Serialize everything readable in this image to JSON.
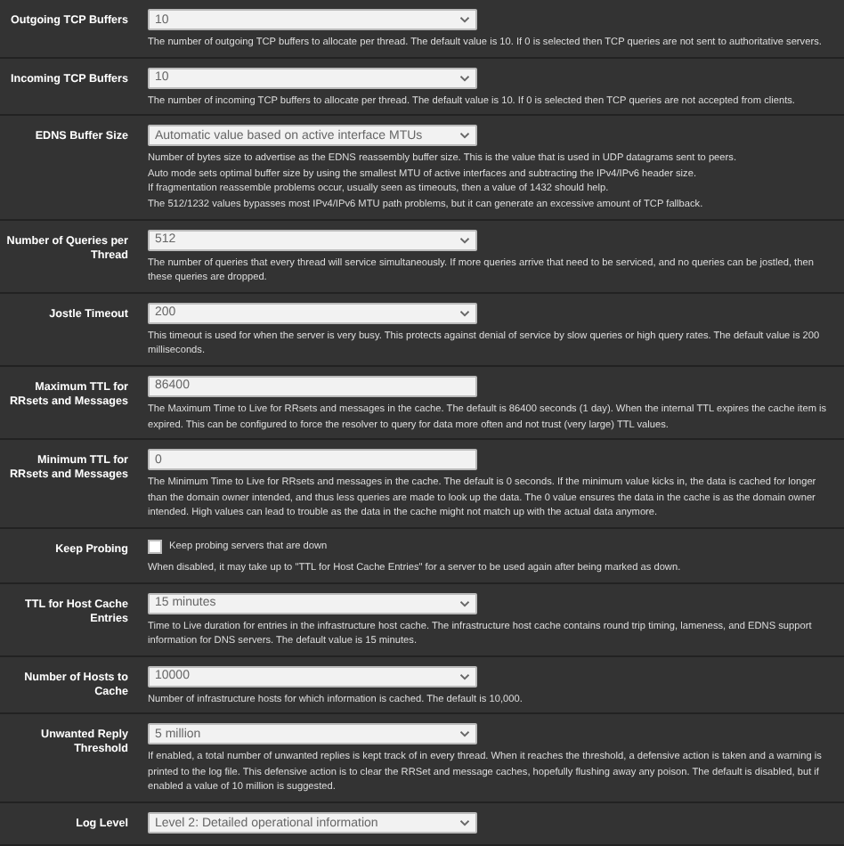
{
  "settings": [
    {
      "kind": "select",
      "label": "Outgoing TCP Buffers",
      "value": "10",
      "help": [
        "The number of outgoing TCP buffers to allocate per thread. The default value is 10. If 0 is selected then TCP queries are not sent to authoritative servers."
      ]
    },
    {
      "kind": "select",
      "label": "Incoming TCP Buffers",
      "value": "10",
      "help": [
        "The number of incoming TCP buffers to allocate per thread. The default value is 10. If 0 is selected then TCP queries are not accepted from clients."
      ]
    },
    {
      "kind": "select",
      "label": "EDNS Buffer Size",
      "value": "Automatic value based on active interface MTUs",
      "help": [
        "Number of bytes size to advertise as the EDNS reassembly buffer size. This is the value that is used in UDP datagrams sent to peers.",
        "Auto mode sets optimal buffer size by using the smallest MTU of active interfaces and subtracting the IPv4/IPv6 header size.",
        "If fragmentation reassemble problems occur, usually seen as timeouts, then a value of 1432 should help.",
        "The 512/1232 values bypasses most IPv4/IPv6 MTU path problems, but it can generate an excessive amount of TCP fallback."
      ]
    },
    {
      "kind": "select",
      "label": "Number of Queries per Thread",
      "value": "512",
      "help": [
        "The number of queries that every thread will service simultaneously. If more queries arrive that need to be serviced, and no queries can be jostled, then these queries are dropped."
      ]
    },
    {
      "kind": "select",
      "label": "Jostle Timeout",
      "value": "200",
      "help": [
        "This timeout is used for when the server is very busy. This protects against denial of service by slow queries or high query rates. The default value is 200 milliseconds."
      ]
    },
    {
      "kind": "input",
      "label": "Maximum TTL for RRsets and Messages",
      "value": "86400",
      "help": [
        "The Maximum Time to Live for RRsets and messages in the cache. The default is 86400 seconds (1 day). When the internal TTL expires the cache item is expired. This can be configured to force the resolver to query for data more often and not trust (very large) TTL values."
      ]
    },
    {
      "kind": "input",
      "label": "Minimum TTL for RRsets and Messages",
      "value": "0",
      "help": [
        "The Minimum Time to Live for RRsets and messages in the cache. The default is 0 seconds. If the minimum value kicks in, the data is cached for longer than the domain owner intended, and thus less queries are made to look up the data. The 0 value ensures the data in the cache is as the domain owner intended. High values can lead to trouble as the data in the cache might not match up with the actual data anymore."
      ]
    },
    {
      "kind": "checkbox",
      "label": "Keep Probing",
      "value": "Keep probing servers that are down",
      "checked": false,
      "help": [
        "When disabled, it may take up to \"TTL for Host Cache Entries\" for a server to be used again after being marked as down."
      ]
    },
    {
      "kind": "select",
      "label": "TTL for Host Cache Entries",
      "value": "15 minutes",
      "help": [
        "Time to Live duration for entries in the infrastructure host cache. The infrastructure host cache contains round trip timing, lameness, and EDNS support information for DNS servers. The default value is 15 minutes."
      ]
    },
    {
      "kind": "select",
      "label": "Number of Hosts to Cache",
      "value": "10000",
      "help": [
        "Number of infrastructure hosts for which information is cached. The default is 10,000."
      ]
    },
    {
      "kind": "select",
      "label": "Unwanted Reply Threshold",
      "value": "5 million",
      "help": [
        "If enabled, a total number of unwanted replies is kept track of in every thread. When it reaches the threshold, a defensive action is taken and a warning is printed to the log file. This defensive action is to clear the RRSet and message caches, hopefully flushing away any poison. The default is disabled, but if enabled a value of 10 million is suggested."
      ]
    },
    {
      "kind": "select",
      "label": "Log Level",
      "value": "Level 2: Detailed operational information"
    }
  ]
}
